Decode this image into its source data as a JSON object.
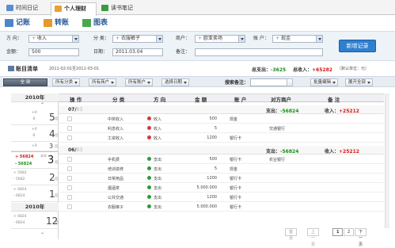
{
  "tabs": [
    {
      "label": "时间日记",
      "active": false,
      "icon": "calendar-icon",
      "color": "#5a8ed0"
    },
    {
      "label": "个人理财",
      "active": true,
      "icon": "finance-icon",
      "color": "#e8a030"
    },
    {
      "label": "读书笔记",
      "active": false,
      "icon": "book-icon",
      "color": "#3c9b3c"
    }
  ],
  "toolbar": {
    "record": "记账",
    "transfer": "转账",
    "chart": "图表"
  },
  "form": {
    "direction_label": "方 向：",
    "direction_prefix": "+",
    "direction_value": "收入",
    "category_label": "分 类：",
    "category_prefix": "+",
    "category_value": "衣服裤子",
    "merchant_label": "商户：",
    "merchant_prefix": "+",
    "merchant_value": "欧亚卖场",
    "account_label": "账 户：",
    "account_prefix": "+",
    "account_value": "现金",
    "amount_label": "金额：",
    "amount_value": "500",
    "date_label": "日期：",
    "date_value": "2011.03.04",
    "remark_label": "备注：",
    "remark_value": "",
    "new_button": "新增记录"
  },
  "ledger": {
    "title": "账目清单",
    "date_range": "2011-02-01至2011-03-01",
    "total_expense_label": "总支出：",
    "total_expense": "-3625",
    "total_income_label": "总收入：",
    "total_income": "+65282",
    "option": "（默认单位：元）"
  },
  "filters": {
    "all": "全 部",
    "category": "所有分类",
    "merchant": "所有商户",
    "account": "所有账户",
    "date": "选择日期",
    "search_label": "搜索备注：",
    "search_value": "",
    "batch": "批量编辑",
    "expand": "展开全部"
  },
  "sidebar": {
    "year_top": "2010年",
    "year_bottom": "2010年",
    "months": [
      {
        "plus": "+0",
        "minus": "-0",
        "month": "5",
        "unit": "月"
      },
      {
        "plus": "+0",
        "minus": "-0",
        "month": "4",
        "unit": "月"
      },
      {
        "plus": "+0",
        "minus": "-0",
        "month": "3",
        "unit": "月"
      },
      {
        "plus": "+ 56824",
        "minus": "- 56824",
        "month": "3",
        "unit": "月",
        "selected": true,
        "year_flag": "本年"
      },
      {
        "plus": "+ 5682",
        "minus": "- 5682",
        "month": "2",
        "unit": "月"
      },
      {
        "plus": "+ 6824",
        "minus": "- 6824",
        "month": "1",
        "unit": "月"
      },
      {
        "plus": "+ 6824",
        "minus": "- 6824",
        "month": "12",
        "unit": "月"
      }
    ]
  },
  "grid": {
    "headers": [
      "操 作",
      "分 类",
      "方 向",
      "金 额",
      "账 户",
      "对方商户",
      "备 注"
    ],
    "days": [
      {
        "date": "07/",
        "date_suffix": "03",
        "expense_label": "支出：",
        "expense": "-56824",
        "income_label": "收入：",
        "income": "+25212",
        "rows": [
          {
            "category": "中奖收入",
            "dir_icon": "income-icon",
            "direction": "收入",
            "amount": "500",
            "account": "现金",
            "merchant": "",
            "remark": ""
          },
          {
            "category": "利息收入",
            "dir_icon": "income-icon",
            "direction": "收入",
            "amount": "5",
            "account": "",
            "merchant": "交通银行",
            "remark": ""
          },
          {
            "category": "工资收入",
            "dir_icon": "income-icon",
            "direction": "收入",
            "amount": "1200",
            "account": "银行卡",
            "merchant": "",
            "remark": ""
          }
        ]
      },
      {
        "date": "06/",
        "date_suffix": "03",
        "expense_label": "支出：",
        "expense": "-56824",
        "income_label": "收入：",
        "income": "+25212",
        "rows": [
          {
            "category": "手机费",
            "dir_icon": "expense-icon",
            "direction": "支出",
            "amount": "500",
            "account": "银行卡",
            "merchant": "农业银行",
            "remark": ""
          },
          {
            "category": "培训进修",
            "dir_icon": "expense-icon",
            "direction": "支出",
            "amount": "5",
            "account": "现金",
            "merchant": "",
            "remark": ""
          },
          {
            "category": "日常用品",
            "dir_icon": "expense-icon",
            "direction": "支出",
            "amount": "1200",
            "account": "银行卡",
            "merchant": "",
            "remark": ""
          },
          {
            "category": "烟酒茶",
            "dir_icon": "expense-icon",
            "direction": "支出",
            "amount": "5.000.000",
            "account": "银行卡",
            "merchant": "",
            "remark": ""
          },
          {
            "category": "公共交通",
            "dir_icon": "expense-icon",
            "direction": "支出",
            "amount": "1200",
            "account": "银行卡",
            "merchant": "",
            "remark": ""
          },
          {
            "category": "衣服裤子",
            "dir_icon": "expense-icon",
            "direction": "支出",
            "amount": "5.000.000",
            "account": "银行卡",
            "merchant": "",
            "remark": ""
          }
        ]
      }
    ]
  },
  "pager": {
    "first": "首 页",
    "prev": "上一页",
    "p1": "1",
    "p2": "2",
    "next": "下一页"
  }
}
